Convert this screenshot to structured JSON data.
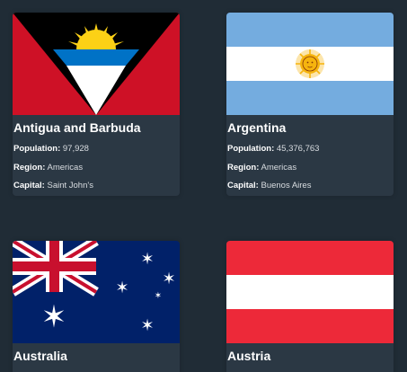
{
  "countries": [
    {
      "name": "Antigua and Barbuda",
      "population_label": "Population:",
      "population": "97,928",
      "region_label": "Region:",
      "region": "Americas",
      "capital_label": "Capital:",
      "capital": "Saint John's",
      "flag_icon": "antigua-and-barbuda-flag-icon"
    },
    {
      "name": "Argentina",
      "population_label": "Population:",
      "population": "45,376,763",
      "region_label": "Region:",
      "region": "Americas",
      "capital_label": "Capital:",
      "capital": "Buenos Aires",
      "flag_icon": "argentina-flag-icon"
    },
    {
      "name": "Australia",
      "flag_icon": "australia-flag-icon"
    },
    {
      "name": "Austria",
      "flag_icon": "austria-flag-icon"
    }
  ],
  "colors": {
    "background": "#202c36",
    "card": "#2b3844",
    "text": "#ffffff"
  }
}
